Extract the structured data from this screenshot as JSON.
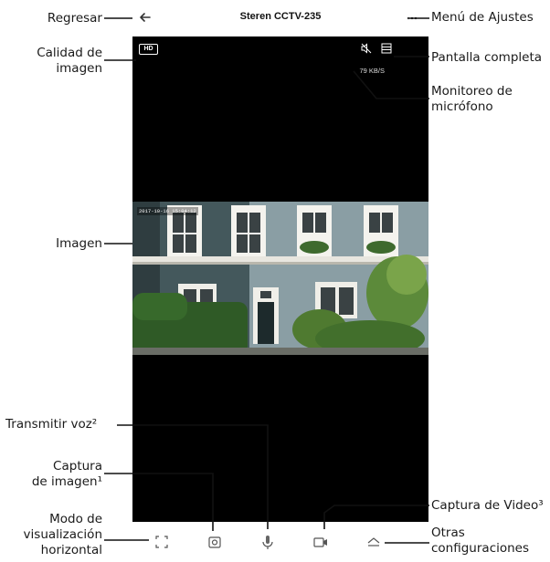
{
  "app": {
    "title": "Steren CCTV-235"
  },
  "stream": {
    "quality_badge": "HD",
    "bitrate": "79 KB/S",
    "timestamp": "2017-10-16  15:04:12"
  },
  "icons": {
    "back": "arrow-left-icon",
    "more": "more-dots-icon",
    "mute": "speaker-muted-icon",
    "fullscreen": "fullscreen-icon",
    "landscape": "landscape-view-icon",
    "snapshot": "camera-snapshot-icon",
    "talk": "microphone-icon",
    "record": "video-record-icon",
    "settings": "eject-menu-icon"
  },
  "annotations": {
    "back": "Regresar",
    "settings_menu": "Menú de Ajustes",
    "quality_line1": "Calidad de",
    "quality_line2": "imagen",
    "fullscreen": "Pantalla completa",
    "mic_line1": "Monitoreo de",
    "mic_line2": "micrófono",
    "image": "Imagen",
    "voice": "Transmitir voz²",
    "capture_image_line1": "Captura",
    "capture_image_line2": "de imagen¹",
    "capture_video": "Captura de Video³",
    "landscape_line1": "Modo de",
    "landscape_line2": "visualización",
    "landscape_line3": "horizontal",
    "other_line1": "Otras",
    "other_line2": "configuraciones"
  },
  "colors": {
    "annotation_line": "#111111",
    "screen_bg": "#000000",
    "bar_bg": "#ffffff"
  }
}
